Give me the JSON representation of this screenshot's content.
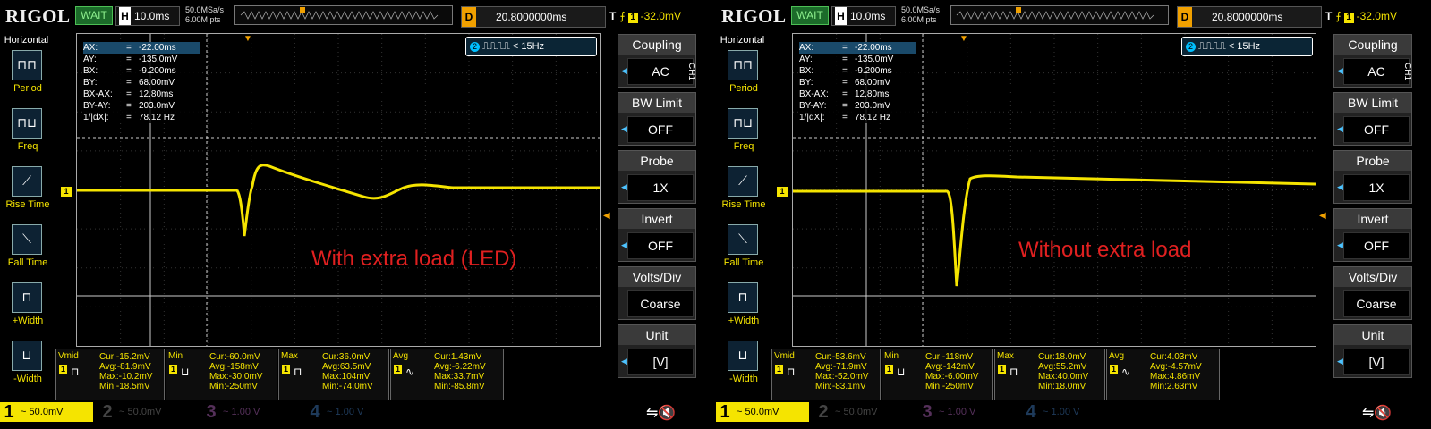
{
  "panels": [
    {
      "top": {
        "logo": "RIGOL",
        "status": "WAIT",
        "h_label": "H",
        "timebase": "10.0ms",
        "sample_rate": "50.0MSa/s",
        "mem_depth": "6.00M pts",
        "d_label": "D",
        "delay": "20.8000000ms",
        "t_label": "T",
        "trig_ch": "1",
        "trig_level": "-32.0mV"
      },
      "horizontal": {
        "title": "Horizontal",
        "items": [
          "Period",
          "Freq",
          "Rise Time",
          "Fall Time",
          "+Width",
          "-Width"
        ]
      },
      "cursor": [
        [
          "AX:",
          "=",
          "-22.00ms"
        ],
        [
          "AY:",
          "=",
          "-135.0mV"
        ],
        [
          "BX:",
          "=",
          "-9.200ms"
        ],
        [
          "BY:",
          "=",
          "68.00mV"
        ],
        [
          "BX-AX:",
          "=",
          "12.80ms"
        ],
        [
          "BY-AY:",
          "=",
          "203.0mV"
        ],
        [
          "1/|dX|:",
          "=",
          "78.12 Hz"
        ]
      ],
      "trig_info": {
        "ch": "2",
        "text": "< 15Hz"
      },
      "right_menu": {
        "ch": "CH1",
        "items": [
          {
            "t": "Coupling",
            "v": "AC"
          },
          {
            "t": "BW Limit",
            "v": "OFF"
          },
          {
            "t": "Probe",
            "v": "1X"
          },
          {
            "t": "Invert",
            "v": "OFF"
          },
          {
            "t": "Volts/Div",
            "v": "Coarse"
          },
          {
            "t": "Unit",
            "v": "[V]"
          }
        ]
      },
      "measurements": [
        {
          "name": "Vmid",
          "vals": [
            "Cur:-15.2mV",
            "Avg:-81.9mV",
            "Max:-10.2mV",
            "Min:-18.5mV"
          ]
        },
        {
          "name": "Min",
          "vals": [
            "Cur:-60.0mV",
            "Avg:-158mV",
            "Max:-30.0mV",
            "Min:-250mV"
          ]
        },
        {
          "name": "Max",
          "vals": [
            "Cur:36.0mV",
            "Avg:63.5mV",
            "Max:104mV",
            "Min:-74.0mV"
          ]
        },
        {
          "name": "Avg",
          "vals": [
            "Cur:1.43mV",
            "Avg:-6.22mV",
            "Max:33.7mV",
            "Min:-85.8mV"
          ]
        }
      ],
      "channels": [
        {
          "n": "1",
          "v": "50.0mV"
        },
        {
          "n": "2",
          "v": "50.0mV"
        },
        {
          "n": "3",
          "v": "1.00 V"
        },
        {
          "n": "4",
          "v": "1.00 V"
        }
      ],
      "annotation": "With extra load (LED)",
      "marker_1": "1"
    },
    {
      "top": {
        "logo": "RIGOL",
        "status": "WAIT",
        "h_label": "H",
        "timebase": "10.0ms",
        "sample_rate": "50.0MSa/s",
        "mem_depth": "6.00M pts",
        "d_label": "D",
        "delay": "20.8000000ms",
        "t_label": "T",
        "trig_ch": "1",
        "trig_level": "-32.0mV"
      },
      "horizontal": {
        "title": "Horizontal",
        "items": [
          "Period",
          "Freq",
          "Rise Time",
          "Fall Time",
          "+Width",
          "-Width"
        ]
      },
      "cursor": [
        [
          "AX:",
          "=",
          "-22.00ms"
        ],
        [
          "AY:",
          "=",
          "-135.0mV"
        ],
        [
          "BX:",
          "=",
          "-9.200ms"
        ],
        [
          "BY:",
          "=",
          "68.00mV"
        ],
        [
          "BX-AX:",
          "=",
          "12.80ms"
        ],
        [
          "BY-AY:",
          "=",
          "203.0mV"
        ],
        [
          "1/|dX|:",
          "=",
          "78.12 Hz"
        ]
      ],
      "trig_info": {
        "ch": "2",
        "text": "< 15Hz"
      },
      "right_menu": {
        "ch": "CH1",
        "items": [
          {
            "t": "Coupling",
            "v": "AC"
          },
          {
            "t": "BW Limit",
            "v": "OFF"
          },
          {
            "t": "Probe",
            "v": "1X"
          },
          {
            "t": "Invert",
            "v": "OFF"
          },
          {
            "t": "Volts/Div",
            "v": "Coarse"
          },
          {
            "t": "Unit",
            "v": "[V]"
          }
        ]
      },
      "measurements": [
        {
          "name": "Vmid",
          "vals": [
            "Cur:-53.6mV",
            "Avg:-71.9mV",
            "Max:-52.0mV",
            "Min:-83.1mV"
          ]
        },
        {
          "name": "Min",
          "vals": [
            "Cur:-118mV",
            "Avg:-142mV",
            "Max:-6.00mV",
            "Min:-250mV"
          ]
        },
        {
          "name": "Max",
          "vals": [
            "Cur:18.0mV",
            "Avg:55.2mV",
            "Max:40.0mV",
            "Min:18.0mV"
          ]
        },
        {
          "name": "Avg",
          "vals": [
            "Cur:4.03mV",
            "Avg:-4.57mV",
            "Max:4.86mV",
            "Min:2.63mV"
          ]
        }
      ],
      "channels": [
        {
          "n": "1",
          "v": "50.0mV"
        },
        {
          "n": "2",
          "v": "50.0mV"
        },
        {
          "n": "3",
          "v": "1.00 V"
        },
        {
          "n": "4",
          "v": "1.00 V"
        }
      ],
      "annotation": "Without extra load",
      "marker_1": "1"
    }
  ],
  "colors": {
    "ch1": "#f5e400",
    "trigger": "#f0a000",
    "ch2": "#00bfff",
    "annotation": "#e02020"
  }
}
